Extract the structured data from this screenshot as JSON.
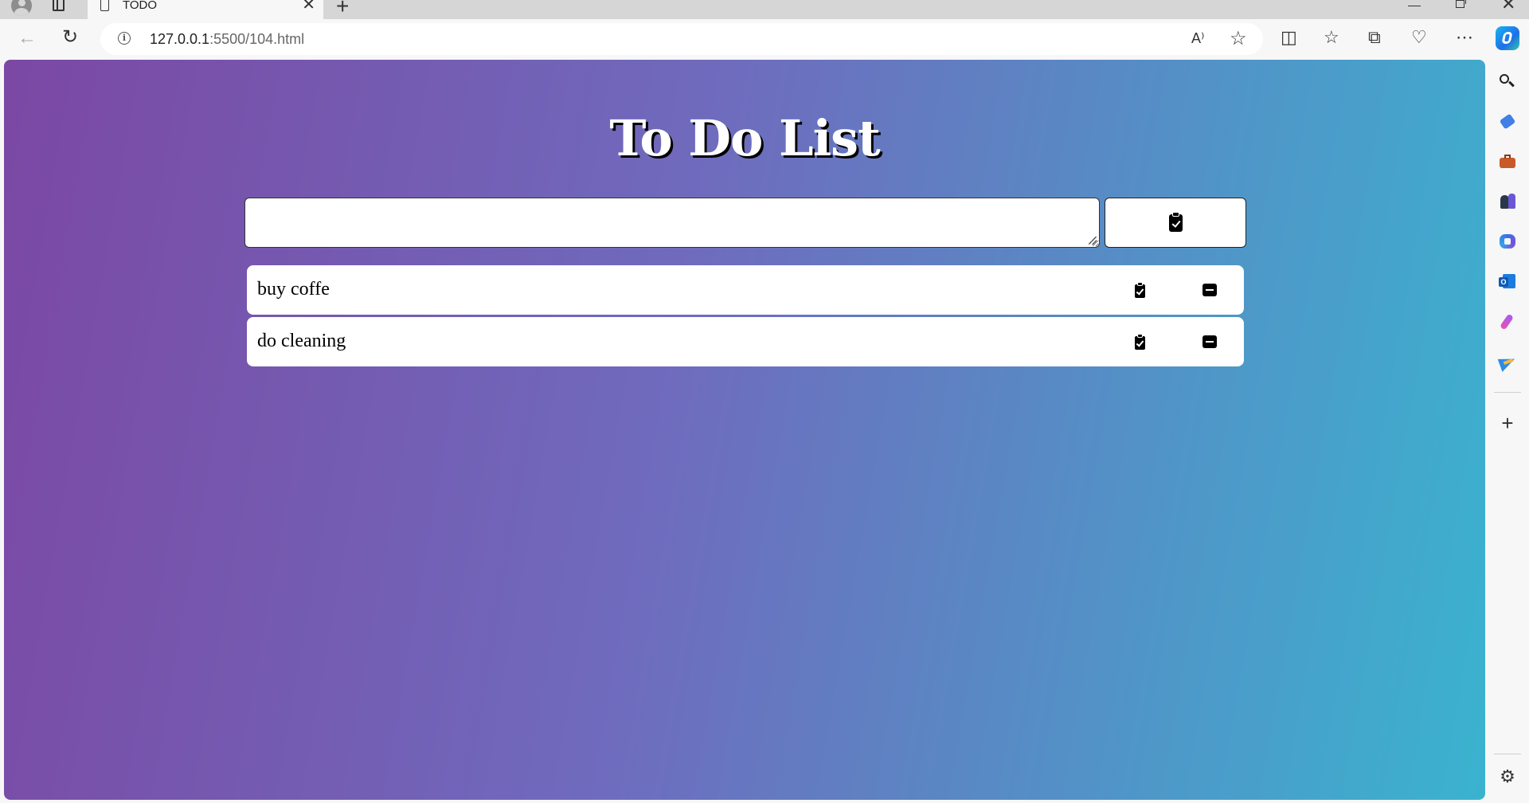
{
  "browser": {
    "tab_title": "TODO",
    "tab_close": "✕",
    "new_tab": "+",
    "url_host": "127.0.0.1",
    "url_path": ":5500/104.html",
    "read_aloud": "A⁾",
    "favorite_star": "☆",
    "window_close": "✕"
  },
  "page": {
    "title": "To Do List",
    "input": {
      "value": "",
      "placeholder": ""
    },
    "items": [
      {
        "text": "buy coffe"
      },
      {
        "text": "do cleaning"
      }
    ]
  },
  "sidebar": {
    "plus": "+",
    "gear": "⚙"
  },
  "colors": {
    "gradient_start": "#7b48a4",
    "gradient_mid": "#6f6bbd",
    "gradient_end": "#3ab3cf"
  }
}
